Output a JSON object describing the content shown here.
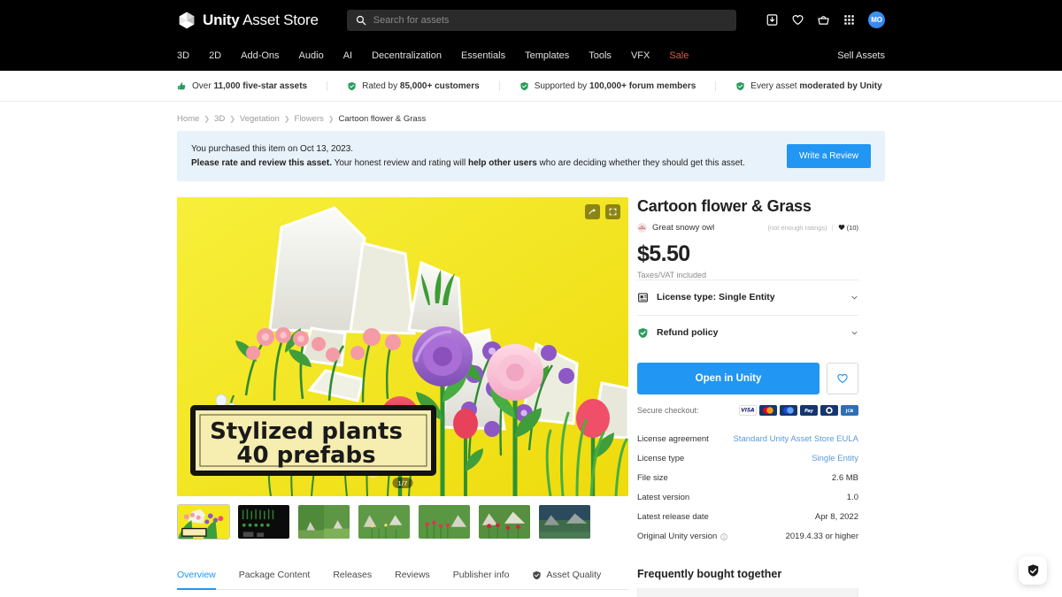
{
  "header": {
    "logo_text_bold": "Unity",
    "logo_text_light": " Asset Store",
    "logo_icon": "unity-cube-icon",
    "search": {
      "placeholder": "Search for assets",
      "value": "",
      "icon": "search-icon"
    },
    "icons": [
      {
        "name": "downloads-icon",
        "label": "Downloads"
      },
      {
        "name": "heart-icon",
        "label": "Wishlist"
      },
      {
        "name": "cart-icon",
        "label": "Cart"
      },
      {
        "name": "apps-grid-icon",
        "label": "Apps"
      }
    ],
    "avatar_initials": "MO",
    "categories": [
      {
        "label": "3D",
        "sale": false
      },
      {
        "label": "2D",
        "sale": false
      },
      {
        "label": "Add-Ons",
        "sale": false
      },
      {
        "label": "Audio",
        "sale": false
      },
      {
        "label": "AI",
        "sale": false
      },
      {
        "label": "Decentralization",
        "sale": false
      },
      {
        "label": "Essentials",
        "sale": false
      },
      {
        "label": "Templates",
        "sale": false
      },
      {
        "label": "Tools",
        "sale": false
      },
      {
        "label": "VFX",
        "sale": false
      },
      {
        "label": "Sale",
        "sale": true
      }
    ],
    "sell_assets": "Sell Assets"
  },
  "trustbar": [
    {
      "icon": "thumbs-up-icon",
      "pre": "Over ",
      "bold": "11,000 five-star assets",
      "post": ""
    },
    {
      "icon": "check-shield-icon",
      "pre": "Rated by ",
      "bold": "85,000+ customers",
      "post": ""
    },
    {
      "icon": "check-shield-icon",
      "pre": "Supported by ",
      "bold": "100,000+ forum members",
      "post": ""
    },
    {
      "icon": "check-shield-icon",
      "pre": "Every asset ",
      "bold": "moderated by Unity",
      "post": ""
    }
  ],
  "breadcrumb": [
    "Home",
    "3D",
    "Vegetation",
    "Flowers",
    "Cartoon flower & Grass"
  ],
  "banner": {
    "line1": "You purchased this item on Oct 13, 2023.",
    "line2_bold1": "Please rate and review this asset.",
    "line2_mid": " Your honest review and rating will ",
    "line2_bold2": "help other users",
    "line2_end": " who are deciding whether they should get this asset.",
    "button": "Write a Review"
  },
  "gallery": {
    "counter": "1/7",
    "hero_caption_line1": "Stylized plants",
    "hero_caption_line2": "40 prefabs",
    "controls": [
      {
        "name": "expand-arrow-icon"
      },
      {
        "name": "fullscreen-icon"
      }
    ],
    "thumbnails": [
      {
        "name": "thumb-hero-yellow",
        "active": true
      },
      {
        "name": "thumb-dark-catalog",
        "active": false
      },
      {
        "name": "thumb-green-scene-1",
        "active": false
      },
      {
        "name": "thumb-green-scene-2",
        "active": false
      },
      {
        "name": "thumb-red-flowers",
        "active": false
      },
      {
        "name": "thumb-red-flowers-rocks",
        "active": false
      },
      {
        "name": "thumb-dusk-scene",
        "active": false
      }
    ]
  },
  "tabs": [
    {
      "label": "Overview",
      "active": true,
      "icon": ""
    },
    {
      "label": "Package Content",
      "active": false,
      "icon": ""
    },
    {
      "label": "Releases",
      "active": false,
      "icon": ""
    },
    {
      "label": "Reviews",
      "active": false,
      "icon": ""
    },
    {
      "label": "Publisher info",
      "active": false,
      "icon": ""
    },
    {
      "label": "Asset Quality",
      "active": false,
      "icon": "shield-check-icon"
    }
  ],
  "product": {
    "title": "Cartoon flower & Grass",
    "publisher": "Great snowy owl",
    "publisher_avatar_icon": "owl-avatar-icon",
    "ratings_text": "(not enough ratings)",
    "favorites_count": "(10)",
    "favorites_icon": "heart-filled-icon",
    "price": "$5.50",
    "tax_note": "Taxes/VAT included",
    "accordions": [
      {
        "label": "License type: Single Entity",
        "icon": "license-doc-icon"
      },
      {
        "label": "Refund policy",
        "icon": "check-shield-icon"
      }
    ],
    "cta_label": "Open in Unity",
    "wishlist_icon": "heart-outline-icon",
    "secure_checkout_label": "Secure checkout:",
    "payment_methods": [
      "VISA",
      "Mastercard",
      "Maestro",
      "PayPal",
      "Diners Club",
      "JCB"
    ],
    "details": [
      {
        "key": "License agreement",
        "value": "Standard Unity Asset Store EULA",
        "link": true,
        "info": false
      },
      {
        "key": "License type",
        "value": "Single Entity",
        "link": true,
        "info": false
      },
      {
        "key": "File size",
        "value": "2.6 MB",
        "link": false,
        "info": false
      },
      {
        "key": "Latest version",
        "value": "1.0",
        "link": false,
        "info": false
      },
      {
        "key": "Latest release date",
        "value": "Apr 8, 2022",
        "link": false,
        "info": false
      },
      {
        "key": "Original Unity version",
        "value": "2019.4.33 or higher",
        "link": false,
        "info": true
      }
    ],
    "fbt_title": "Frequently bought together"
  },
  "chat": {
    "icon": "shield-check-badge-icon"
  },
  "colors": {
    "accent_blue": "#2196f3",
    "sale_red": "#e2574c",
    "green": "#2a9d5c",
    "hero_yellow": "#f3e61a",
    "banner_bg": "#e8f2fb",
    "link_blue": "#5b9bd5"
  }
}
